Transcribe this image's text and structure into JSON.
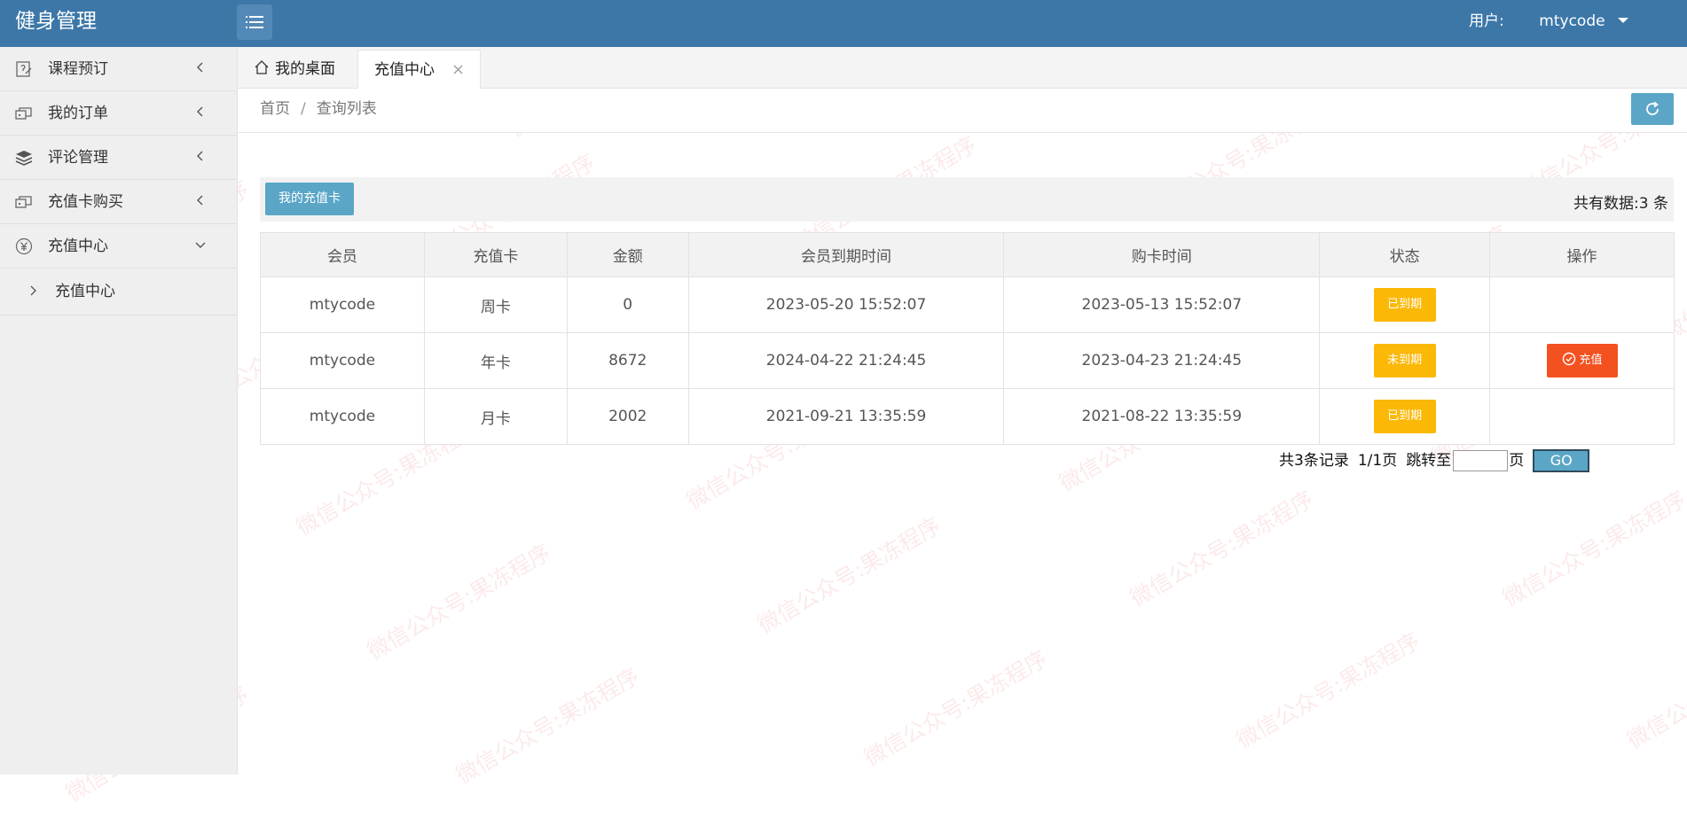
{
  "app": {
    "title": "健身管理"
  },
  "header": {
    "user_label": "用户:",
    "user_name": "mtycode"
  },
  "sidebar": {
    "items": [
      {
        "label": "课程预订"
      },
      {
        "label": "我的订单"
      },
      {
        "label": "评论管理"
      },
      {
        "label": "充值卡购买"
      },
      {
        "label": "充值中心"
      }
    ],
    "sub_items": [
      {
        "label": "充值中心"
      }
    ]
  },
  "tabs": {
    "home": "我的桌面",
    "active": "充值中心"
  },
  "breadcrumb": {
    "home": "首页",
    "sep": "/",
    "current": "查询列表"
  },
  "toolbar": {
    "my_cards_button": "我的充值卡",
    "total_text": "共有数据:3 条"
  },
  "table": {
    "headers": [
      "会员",
      "充值卡",
      "金额",
      "会员到期时间",
      "购卡时间",
      "状态",
      "操作"
    ],
    "rows": [
      {
        "member": "mtycode",
        "card": "周卡",
        "amount": "0",
        "expire": "2023-05-20 15:52:07",
        "bought": "2023-05-13 15:52:07",
        "status": "已到期",
        "action": ""
      },
      {
        "member": "mtycode",
        "card": "年卡",
        "amount": "8672",
        "expire": "2024-04-22 21:24:45",
        "bought": "2023-04-23 21:24:45",
        "status": "未到期",
        "action": "充值"
      },
      {
        "member": "mtycode",
        "card": "月卡",
        "amount": "2002",
        "expire": "2021-09-21 13:35:59",
        "bought": "2021-08-22 13:35:59",
        "status": "已到期",
        "action": ""
      }
    ]
  },
  "pager": {
    "records": "共3条记录",
    "pages": "1/1页",
    "jump_label": "跳转至",
    "page_unit": "页",
    "go": "GO",
    "jump_value": ""
  },
  "watermark": "微信公众号:果冻程序",
  "colors": {
    "header": "#3c77a8",
    "accent": "#5ba6c7",
    "warning": "#fbb806",
    "danger": "#f45121"
  },
  "icons": {
    "menu": "menu-icon",
    "sidebar": [
      "edit-icon",
      "order-icon",
      "layers-icon",
      "card-icon",
      "yen-icon"
    ],
    "home": "home-icon",
    "refresh": "refresh-icon",
    "recharge": "check-circle-icon"
  }
}
